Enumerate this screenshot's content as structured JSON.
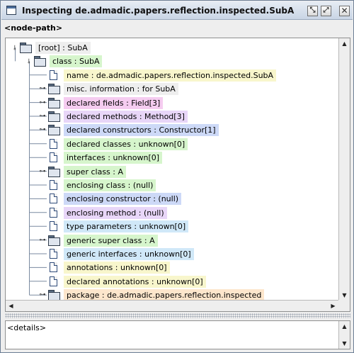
{
  "window": {
    "title": "Inspecting de.admadic.papers.reflection.inspected.SubA",
    "iconify_glyph": "⤡",
    "maximize_glyph": "⤢",
    "close_glyph": "✕"
  },
  "node_path": "<node-path>",
  "tree": [
    {
      "label": "[root] : SubA",
      "type": "folder",
      "toggle": "expanded",
      "color": "#eeeeee",
      "name": "tree-node-root"
    },
    {
      "label": "class : SubA",
      "type": "folder",
      "toggle": "expanded",
      "color": "#d6f5cc",
      "name": "tree-node-class"
    },
    {
      "label": "name : de.admadic.papers.reflection.inspected.SubA",
      "type": "leaf",
      "toggle": "",
      "color": "#f8f6cc",
      "name": "tree-node-name"
    },
    {
      "label": "misc. information : for SubA",
      "type": "folder",
      "toggle": "collapsed",
      "color": "#eeeeee",
      "name": "tree-node-misc-information"
    },
    {
      "label": "declared fields : Field[3]",
      "type": "folder",
      "toggle": "collapsed",
      "color": "#f5ccf0",
      "name": "tree-node-declared-fields"
    },
    {
      "label": "declared methods : Method[3]",
      "type": "folder",
      "toggle": "collapsed",
      "color": "#e8d6f8",
      "name": "tree-node-declared-methods"
    },
    {
      "label": "declared constructors : Constructor[1]",
      "type": "folder",
      "toggle": "collapsed",
      "color": "#cdd9f7",
      "name": "tree-node-declared-constructors"
    },
    {
      "label": "declared classes : unknown[0]",
      "type": "leaf",
      "toggle": "",
      "color": "#d6f5cc",
      "name": "tree-node-declared-classes"
    },
    {
      "label": "interfaces : unknown[0]",
      "type": "leaf",
      "toggle": "",
      "color": "#d6f5cc",
      "name": "tree-node-interfaces"
    },
    {
      "label": "super class : A",
      "type": "folder",
      "toggle": "collapsed",
      "color": "#d6f5cc",
      "name": "tree-node-super-class"
    },
    {
      "label": "enclosing class : (null)",
      "type": "leaf",
      "toggle": "",
      "color": "#d6f5cc",
      "name": "tree-node-enclosing-class"
    },
    {
      "label": "enclosing constructor : (null)",
      "type": "leaf",
      "toggle": "",
      "color": "#cdd9f7",
      "name": "tree-node-enclosing-constructor"
    },
    {
      "label": "enclosing method : (null)",
      "type": "leaf",
      "toggle": "",
      "color": "#e8d6f8",
      "name": "tree-node-enclosing-method"
    },
    {
      "label": "type parameters : unknown[0]",
      "type": "leaf",
      "toggle": "",
      "color": "#d0e8f8",
      "name": "tree-node-type-parameters"
    },
    {
      "label": "generic super class : A",
      "type": "folder",
      "toggle": "collapsed",
      "color": "#d6f5cc",
      "name": "tree-node-generic-super-class"
    },
    {
      "label": "generic interfaces : unknown[0]",
      "type": "leaf",
      "toggle": "",
      "color": "#d0e8f8",
      "name": "tree-node-generic-interfaces"
    },
    {
      "label": "annotations : unknown[0]",
      "type": "leaf",
      "toggle": "",
      "color": "#f8f6cc",
      "name": "tree-node-annotations"
    },
    {
      "label": "declared annotations : unknown[0]",
      "type": "leaf",
      "toggle": "",
      "color": "#f8f6cc",
      "name": "tree-node-declared-annotations"
    },
    {
      "label": "package : de.admadic.papers.reflection.inspected",
      "type": "folder",
      "toggle": "collapsed",
      "color": "#fde6cc",
      "name": "tree-node-package"
    }
  ],
  "details": {
    "text": "<details>"
  },
  "scroll_glyphs": {
    "up": "▲",
    "down": "▼",
    "left": "◀",
    "right": "▶"
  }
}
